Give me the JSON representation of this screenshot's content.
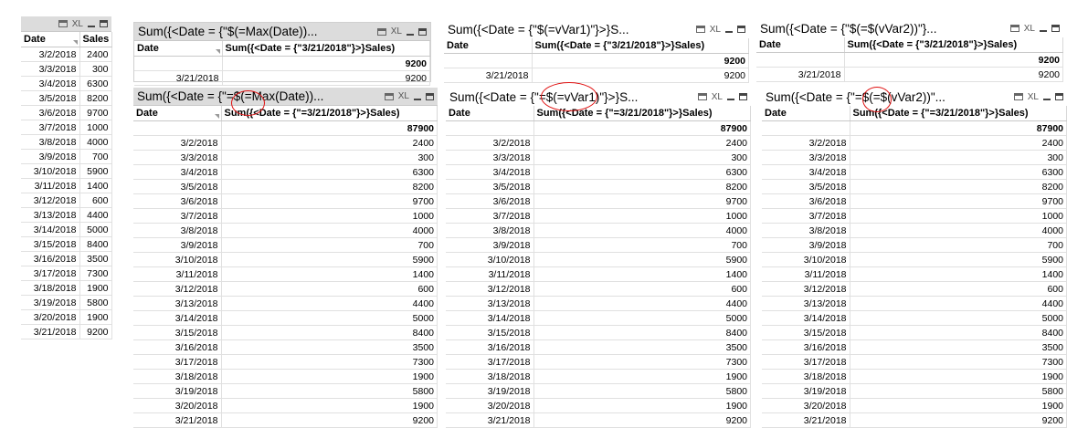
{
  "date_list": [
    "3/2/2018",
    "3/3/2018",
    "3/4/2018",
    "3/5/2018",
    "3/6/2018",
    "3/7/2018",
    "3/8/2018",
    "3/9/2018",
    "3/10/2018",
    "3/11/2018",
    "3/12/2018",
    "3/13/2018",
    "3/14/2018",
    "3/15/2018",
    "3/16/2018",
    "3/17/2018",
    "3/18/2018",
    "3/19/2018",
    "3/20/2018",
    "3/21/2018"
  ],
  "sales_list": [
    "2400",
    "300",
    "6300",
    "8200",
    "9700",
    "1000",
    "4000",
    "700",
    "5900",
    "1400",
    "600",
    "4400",
    "5000",
    "8400",
    "3500",
    "7300",
    "1900",
    "5800",
    "1900",
    "9200"
  ],
  "icons": {
    "print": "print-icon",
    "xl": "XL",
    "minimize": "minimize-icon",
    "maximize": "maximize-icon"
  },
  "colors": {
    "caption_gray": "#dcdcdc",
    "highlight_circle": "#e01010"
  },
  "source_table": {
    "col_date": "Date",
    "col_sales": "Sales"
  },
  "top1": {
    "title": "Sum({<Date = {\"$(=Max(Date))...",
    "col_date": "Date",
    "col_expr": "Sum({<Date = {\"3/21/2018\"}>}Sales)",
    "total": "9200",
    "row_date": "3/21/2018",
    "row_value": "9200"
  },
  "top2": {
    "title": "Sum({<Date = {\"$(=vVar1)\"}>}S...",
    "col_date": "Date",
    "col_expr": "Sum({<Date = {\"3/21/2018\"}>}Sales)",
    "total": "9200",
    "row_date": "3/21/2018",
    "row_value": "9200"
  },
  "top3": {
    "title": "Sum({<Date = {\"$(=$(vVar2))\"}...",
    "col_date": "Date",
    "col_expr": "Sum({<Date = {\"3/21/2018\"}>}Sales)",
    "total": "9200",
    "row_date": "3/21/2018",
    "row_value": "9200"
  },
  "bottom1": {
    "title": "Sum({<Date = {\"=$(=Max(Date))...",
    "col_date": "Date",
    "col_expr": "Sum({<Date = {\"=3/21/2018\"}>}Sales)",
    "total": "87900"
  },
  "bottom2": {
    "title": "Sum({<Date = {\"=$(=vVar1)\"}>}S...",
    "col_date": "Date",
    "col_expr": "Sum({<Date = {\"=3/21/2018\"}>}Sales)",
    "total": "87900"
  },
  "bottom3": {
    "title": "Sum({<Date = {\"=$(=$(vVar2))\"...",
    "col_date": "Date",
    "col_expr": "Sum({<Date = {\"=3/21/2018\"}>}Sales)",
    "total": "87900"
  }
}
